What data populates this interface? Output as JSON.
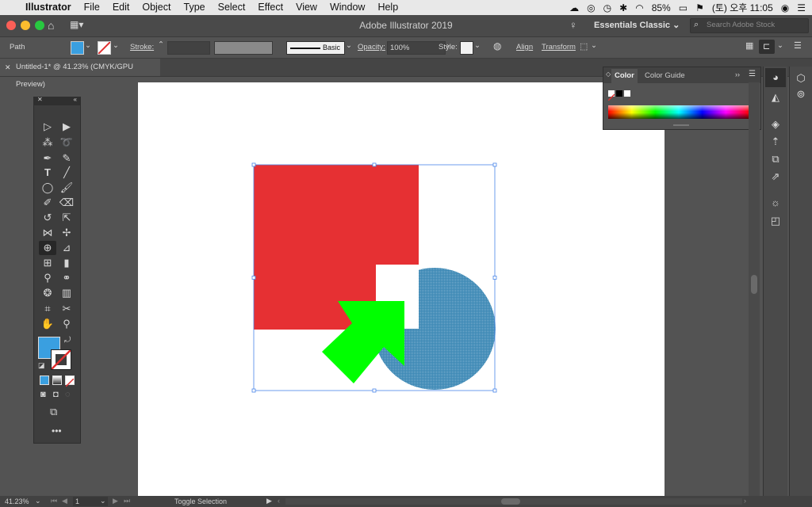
{
  "menubar": {
    "apple": "",
    "app": "Illustrator",
    "items": [
      "File",
      "Edit",
      "Object",
      "Type",
      "Select",
      "Effect",
      "View",
      "Window",
      "Help"
    ],
    "battery": "85%",
    "clock": "(토) 오후 11:05"
  },
  "appbar": {
    "title": "Adobe Illustrator 2019",
    "workspace": "Essentials Classic",
    "search_placeholder": "Search Adobe Stock"
  },
  "controlbar": {
    "selection": "Path",
    "fill_color": "#3a9fe0",
    "stroke_label": "Stroke:",
    "brush_label": "Basic",
    "opacity_label": "Opacity:",
    "opacity_value": "100%",
    "style_label": "Style:",
    "align": "Align",
    "transform": "Transform"
  },
  "doctab": {
    "title": "Untitled-1* @ 41.23% (CMYK/GPU Preview)"
  },
  "color_panel": {
    "tabs": [
      "Color",
      "Color Guide"
    ]
  },
  "status": {
    "zoom": "41.23%",
    "page": "1",
    "toggle": "Toggle Selection"
  },
  "artwork": {
    "square_color": "#e63033",
    "circle_color": "#3d89b5",
    "arrow_color": "#00ff00",
    "selection_color": "#4a86e8"
  }
}
